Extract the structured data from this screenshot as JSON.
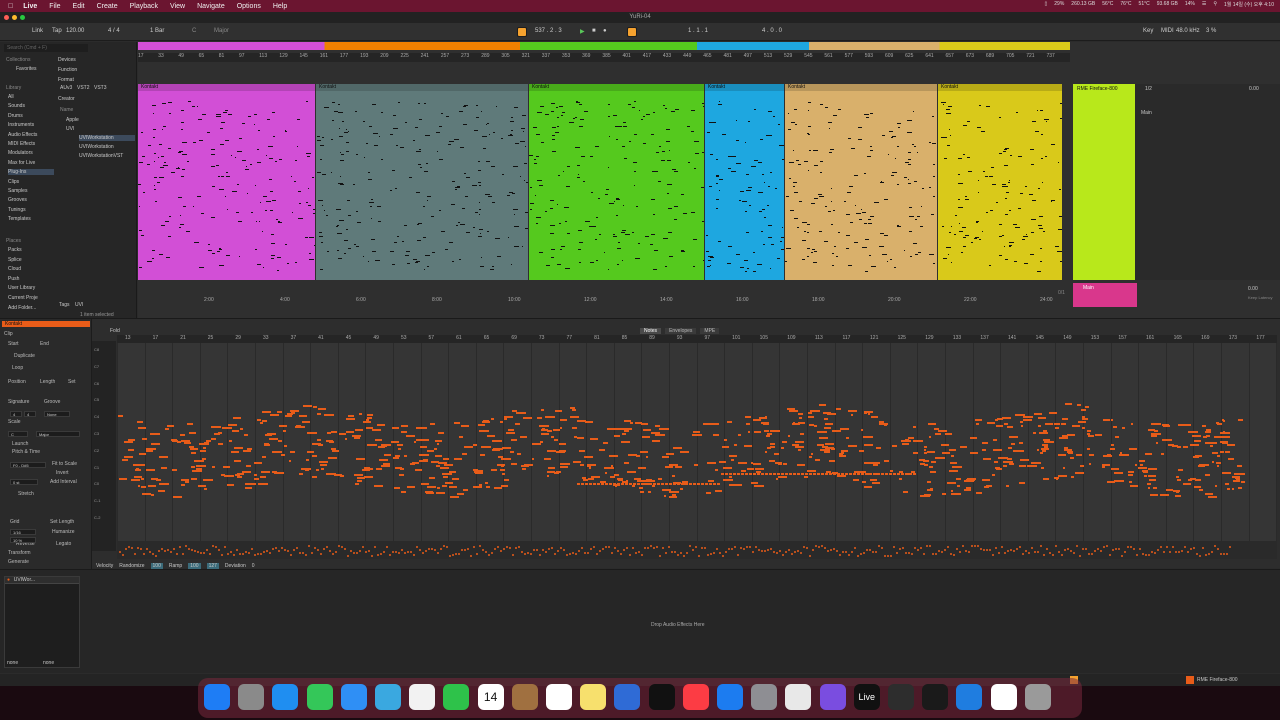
{
  "menubar": {
    "app": "Live",
    "items": [
      "File",
      "Edit",
      "Create",
      "Playback",
      "View",
      "Navigate",
      "Options",
      "Help"
    ],
    "status": [
      "29%",
      "260.13 GB",
      "56°C",
      "76°C",
      "51°C",
      "93.68 GB",
      "14%",
      "1월 14일 (수) 오후 4:10"
    ]
  },
  "window": {
    "title": "YuRi-04"
  },
  "control_bar": {
    "link": "Link",
    "tap": "Tap",
    "tempo": "120.00",
    "signature": "4 / 4",
    "quantize": "1 Bar",
    "key": "C",
    "scale": "Major",
    "position": "537 . 2 . 3",
    "loop_start": "1 . 1 . 1",
    "loop_length": "4 . 0 . 0",
    "key_label": "Key",
    "midi_label": "MIDI",
    "sample_rate": "48.0 kHz",
    "cpu": "3 %"
  },
  "browser": {
    "search_placeholder": "Search (Cmd + F)",
    "collections_title": "Collections",
    "favorites": "Favorites",
    "library_title": "Library",
    "library_items": [
      "All",
      "Sounds",
      "Drums",
      "Instruments",
      "Audio Effects",
      "MIDI Effects",
      "Modulators",
      "Max for Live",
      "Plug-Ins",
      "Clips",
      "Samples",
      "Grooves",
      "Tunings",
      "Templates"
    ],
    "places_title": "Places",
    "places_items": [
      "Packs",
      "Splice",
      "Cloud",
      "Push",
      "User Library",
      "Current Proje",
      "Add Folder..."
    ],
    "filters": [
      "Devices",
      "Function",
      "Format",
      "Creator",
      "Name"
    ],
    "formats": [
      "AUv3",
      "VST2",
      "VST3"
    ],
    "tree": [
      "Apple",
      "UVI",
      "UVIWorkstation",
      "UVIWorkstation",
      "UVIWorkstationVST"
    ],
    "footer_tags": "Tags",
    "footer_uvi": "UVI",
    "footer_selected": "1 item selected"
  },
  "arrangement": {
    "ruler_top": [
      "17",
      "33",
      "49",
      "65",
      "81",
      "97",
      "113",
      "129",
      "145",
      "161",
      "177",
      "193",
      "209",
      "225",
      "241",
      "257",
      "273",
      "289",
      "305",
      "321",
      "337",
      "353",
      "369",
      "385",
      "401",
      "417",
      "433",
      "449",
      "465",
      "481",
      "497",
      "513",
      "529",
      "545",
      "561",
      "577",
      "593",
      "609",
      "625",
      "641",
      "657",
      "673",
      "689",
      "705",
      "721",
      "737"
    ],
    "ruler_bottom": [
      "2:00",
      "4:00",
      "6:00",
      "8:00",
      "10:00",
      "12:00",
      "14:00",
      "16:00",
      "18:00",
      "20:00",
      "22:00",
      "24:00"
    ],
    "clips": [
      {
        "name": "Kontakt",
        "color": "#d24fd6"
      },
      {
        "name": "Kontakt",
        "color": "#5f7a7a"
      },
      {
        "name": "Kontakt",
        "color": "#55c91e"
      },
      {
        "name": "Kontakt",
        "color": "#1ea7e0"
      },
      {
        "name": "Kontakt",
        "color": "#d9b06b"
      },
      {
        "name": "Kontakt",
        "color": "#d9c91a"
      }
    ],
    "track_name": "RME Fireface-800",
    "track_main": "Main",
    "mixer_values": [
      "1/2",
      "0.00",
      "0.00"
    ],
    "ratio": "0/1",
    "keep_latency": "Keep Latency"
  },
  "detail": {
    "clip_title": "Kontakt",
    "labels": [
      "Clip",
      "Start",
      "End",
      "Duplicate",
      "Loop",
      "Position",
      "Length",
      "Set",
      "Signature",
      "Groove",
      "Scale",
      "Launch",
      "Pitch & Time",
      "Fit to Scale",
      "Invert",
      "Add Interval",
      "Stretch",
      "Grid",
      "Set Length",
      "Humanize",
      "Reverse",
      "Legato",
      "Transform",
      "Generate"
    ],
    "scale_key": "C",
    "scale_name": "Major",
    "sig_num": "4",
    "sig_den": "4",
    "groove": "None",
    "range": "F0 - D#5",
    "transpose": "0 st",
    "quant": "1/16",
    "humanize": "10 %",
    "tabs": [
      "Notes",
      "Envelopes",
      "MPE"
    ],
    "fold": "Fold",
    "piano_keys": [
      "C8",
      "C7",
      "C6",
      "C5",
      "C4",
      "C3",
      "C2",
      "C1",
      "C0",
      "C-1",
      "C-2"
    ],
    "velocity_label": "Velocity",
    "randomize": "Randomize",
    "ramp": "Ramp",
    "deviation": "Deviation",
    "velocity_values": [
      "100",
      "127",
      "0"
    ],
    "bar_numbers": [
      "13",
      "17",
      "21",
      "25",
      "29",
      "33",
      "37",
      "41",
      "45",
      "49",
      "53",
      "57",
      "61",
      "65",
      "69",
      "73",
      "77",
      "81",
      "85",
      "89",
      "93",
      "97",
      "101",
      "105",
      "109",
      "113",
      "117",
      "121",
      "125",
      "129",
      "133",
      "137",
      "141",
      "145",
      "149",
      "153",
      "157",
      "161",
      "165",
      "169",
      "173",
      "177"
    ]
  },
  "device": {
    "name": "UVIWor...",
    "drop": "Drop Audio Effects Here",
    "sel1": "none",
    "sel2": "none"
  },
  "status": {
    "output": "RME Fireface-800"
  },
  "dock": [
    "Finder",
    "Launchpad",
    "Safari",
    "Messages",
    "Mail",
    "Maps",
    "Photos",
    "FaceTime",
    "Calendar",
    "Contacts",
    "Reminders",
    "Notes",
    "Freeform",
    "TV",
    "Music",
    "App Store",
    "System Settings",
    "Preview",
    "Feedback",
    "Live",
    "Activity",
    "Chrome",
    "Xcode",
    "Files",
    "Trash"
  ],
  "dock_calendar_date": "14",
  "dock_live_label": "Live"
}
